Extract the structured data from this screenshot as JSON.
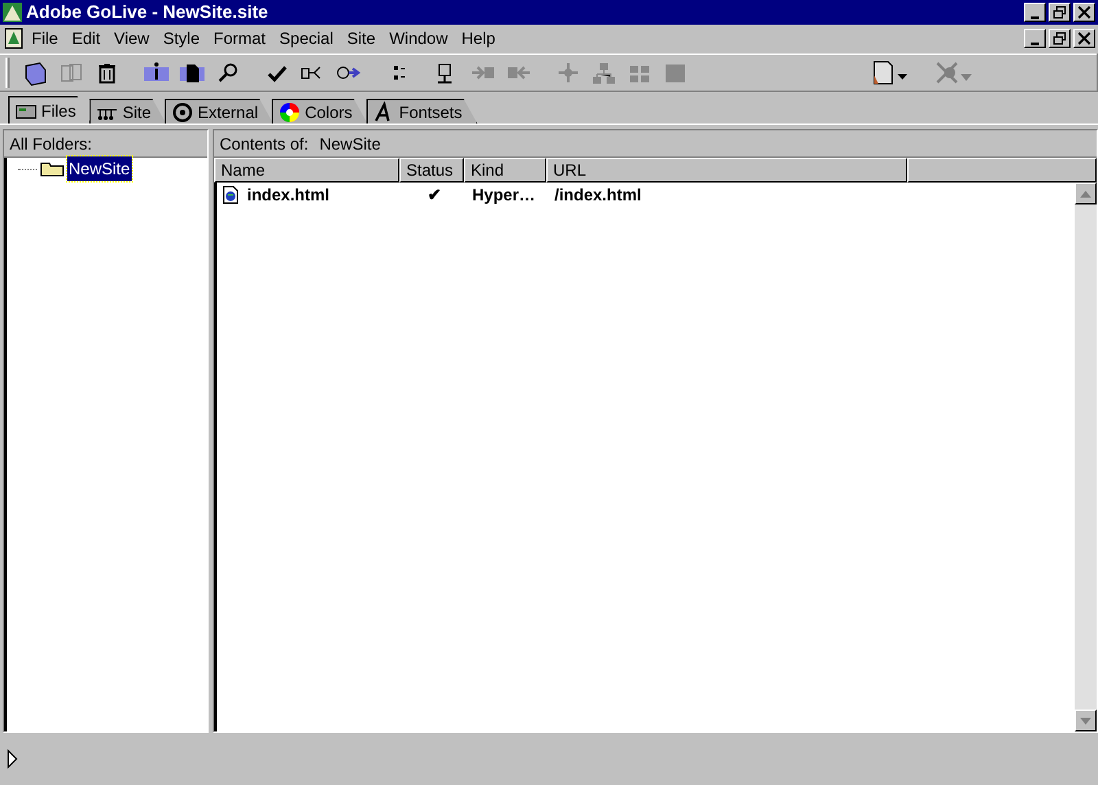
{
  "window": {
    "title": "Adobe GoLive - NewSite.site"
  },
  "menu": [
    "File",
    "Edit",
    "View",
    "Style",
    "Format",
    "Special",
    "Site",
    "Window",
    "Help"
  ],
  "toolbar": [
    {
      "kind": "box",
      "disabled": false
    },
    {
      "kind": "copy",
      "disabled": true
    },
    {
      "kind": "trash",
      "disabled": false
    },
    {
      "kind": "info",
      "disabled": false
    },
    {
      "kind": "page",
      "disabled": false
    },
    {
      "kind": "find",
      "disabled": false
    },
    {
      "kind": "check",
      "disabled": false
    },
    {
      "kind": "link",
      "disabled": false
    },
    {
      "kind": "search",
      "disabled": false
    },
    {
      "kind": "list",
      "disabled": false
    },
    {
      "kind": "net",
      "disabled": false
    },
    {
      "kind": "forward",
      "disabled": true
    },
    {
      "kind": "back",
      "disabled": true
    },
    {
      "kind": "move",
      "disabled": true
    },
    {
      "kind": "tree",
      "disabled": true
    },
    {
      "kind": "grid",
      "disabled": true
    },
    {
      "kind": "square",
      "disabled": true
    }
  ],
  "tabs": [
    {
      "label": "Files",
      "selected": true
    },
    {
      "label": "Site",
      "selected": false
    },
    {
      "label": "External",
      "selected": false
    },
    {
      "label": "Colors",
      "selected": false
    },
    {
      "label": "Fontsets",
      "selected": false
    }
  ],
  "folders": {
    "header": "All Folders:",
    "tree": [
      {
        "label": "NewSite",
        "selected": true
      }
    ]
  },
  "contents": {
    "label": "Contents of:",
    "folder": "NewSite",
    "columns": [
      "Name",
      "Status",
      "Kind",
      "URL"
    ],
    "rows": [
      {
        "name": "index.html",
        "status": "✔",
        "kind": "Hyper…",
        "url": "/index.html"
      }
    ]
  }
}
